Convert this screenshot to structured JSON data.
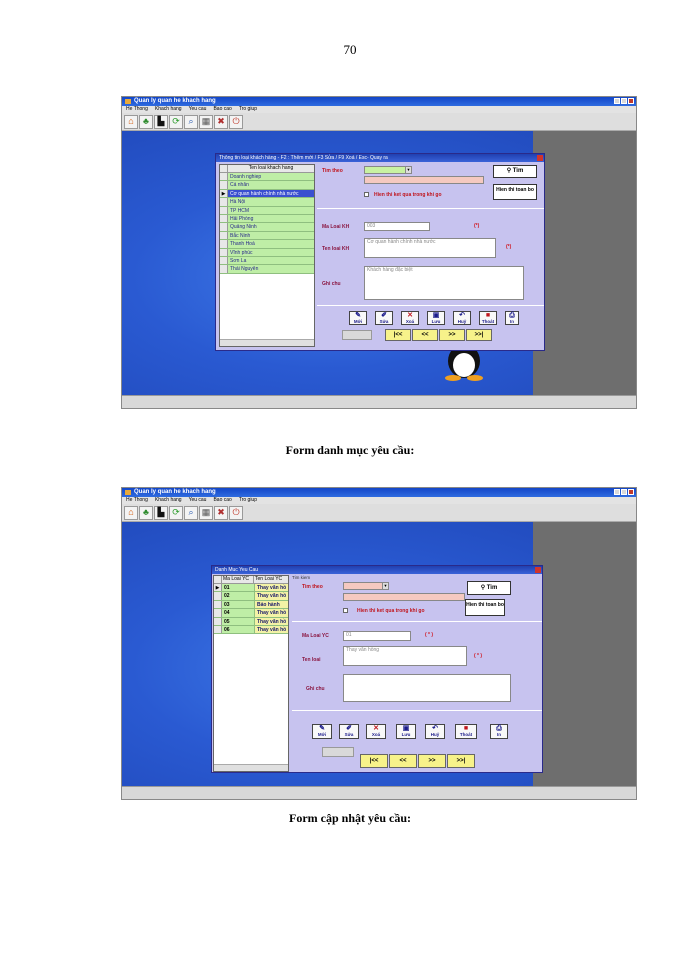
{
  "page_number": "70",
  "caption1": "Form  danh mục  yêu cầu:",
  "caption2": "Form  cập nhật  yêu cầu:",
  "colors": {
    "desktop": "#2b5bd0",
    "dialog": "#c7c3ef",
    "green_cell": "#bfeea6",
    "yellow_cell": "#f3f2a6",
    "label_red": "#c0141c"
  },
  "app": {
    "title": "Quan ly quan he khach hang",
    "menu": [
      "He Thong",
      "Khach hang",
      "Yeu cau",
      "Bao cao",
      "Tro giup"
    ],
    "toolbar_icons": [
      "home-icon",
      "tree-icon",
      "boots-icon",
      "refresh-icon",
      "search-icon",
      "calculator-icon",
      "tools-icon",
      "power-icon"
    ]
  },
  "shot1": {
    "dialog_title": "Thông tin loại khách hàng - F2 : Thêm mới / F3 Sửa / F9 Xoá / Esc- Quay ra",
    "grid_header": "Ten loai khach hang",
    "rows": [
      "Doanh nghiep",
      "Cá nhân",
      "Cơ quan hành chính nhà nước",
      "Hà Nội",
      "TP HCM",
      "Hải Phòng",
      "Quảng Ninh",
      "Bắc Ninh",
      "Thanh Hoá",
      "Vĩnh phúc",
      "Sơn La",
      "Thái Nguyên"
    ],
    "selected_index": 2,
    "search_label": "Tim theo",
    "search_button": "Tim",
    "show_all_button": "Hien thi toan bo",
    "checkbox_label": "Hien thi ket qua trong khi go",
    "ma_loai_label": "Ma Loai KH",
    "ma_loai_value": "003",
    "ten_loai_label": "Ten loai KH",
    "ten_loai_value": "Cơ quan hành chính nhà nước",
    "ghi_chu_label": "Ghi chu",
    "ghi_chu_value": "Khách hàng đặc biệt",
    "required": "(*)",
    "actions": [
      "Mới",
      "Sửa",
      "Xoá",
      "Lưu",
      "Huỷ",
      "Thoát",
      "In"
    ],
    "nav": [
      "|<<",
      "<<",
      ">>",
      ">>|"
    ]
  },
  "shot2": {
    "dialog_title": "Danh Muc Yeu Cau",
    "grid_headers": [
      "Ma Loai YC",
      "Ten Loai YC"
    ],
    "rows": [
      {
        "code": "01",
        "name": "Thay văn hồ"
      },
      {
        "code": "02",
        "name": "Thay văn hồ"
      },
      {
        "code": "03",
        "name": "Bảo hành"
      },
      {
        "code": "04",
        "name": "Thay văn hồ"
      },
      {
        "code": "05",
        "name": "Thay văn hồ"
      },
      {
        "code": "06",
        "name": "Thay văn hồ"
      }
    ],
    "selected_index": 0,
    "group_label": "Tim kiem",
    "search_label": "Tim theo",
    "search_button": "Tim",
    "show_all_button": "Hien thi toan bo",
    "checkbox_label": "Hien thi ket qua trong khi go",
    "ma_loai_label": "Ma Loai YC",
    "ma_loai_value": "01",
    "ten_loai_label": "Ten loai",
    "ten_loai_value": "Thay văn hồng",
    "ghi_chu_label": "Ghi chu",
    "ghi_chu_value": "",
    "required": "( * )",
    "actions": [
      "Mới",
      "Sửa",
      "Xoá",
      "Lưu",
      "Huỷ",
      "Thoát",
      "In"
    ],
    "nav": [
      "|<<",
      "<<",
      ">>",
      ">>|"
    ]
  }
}
